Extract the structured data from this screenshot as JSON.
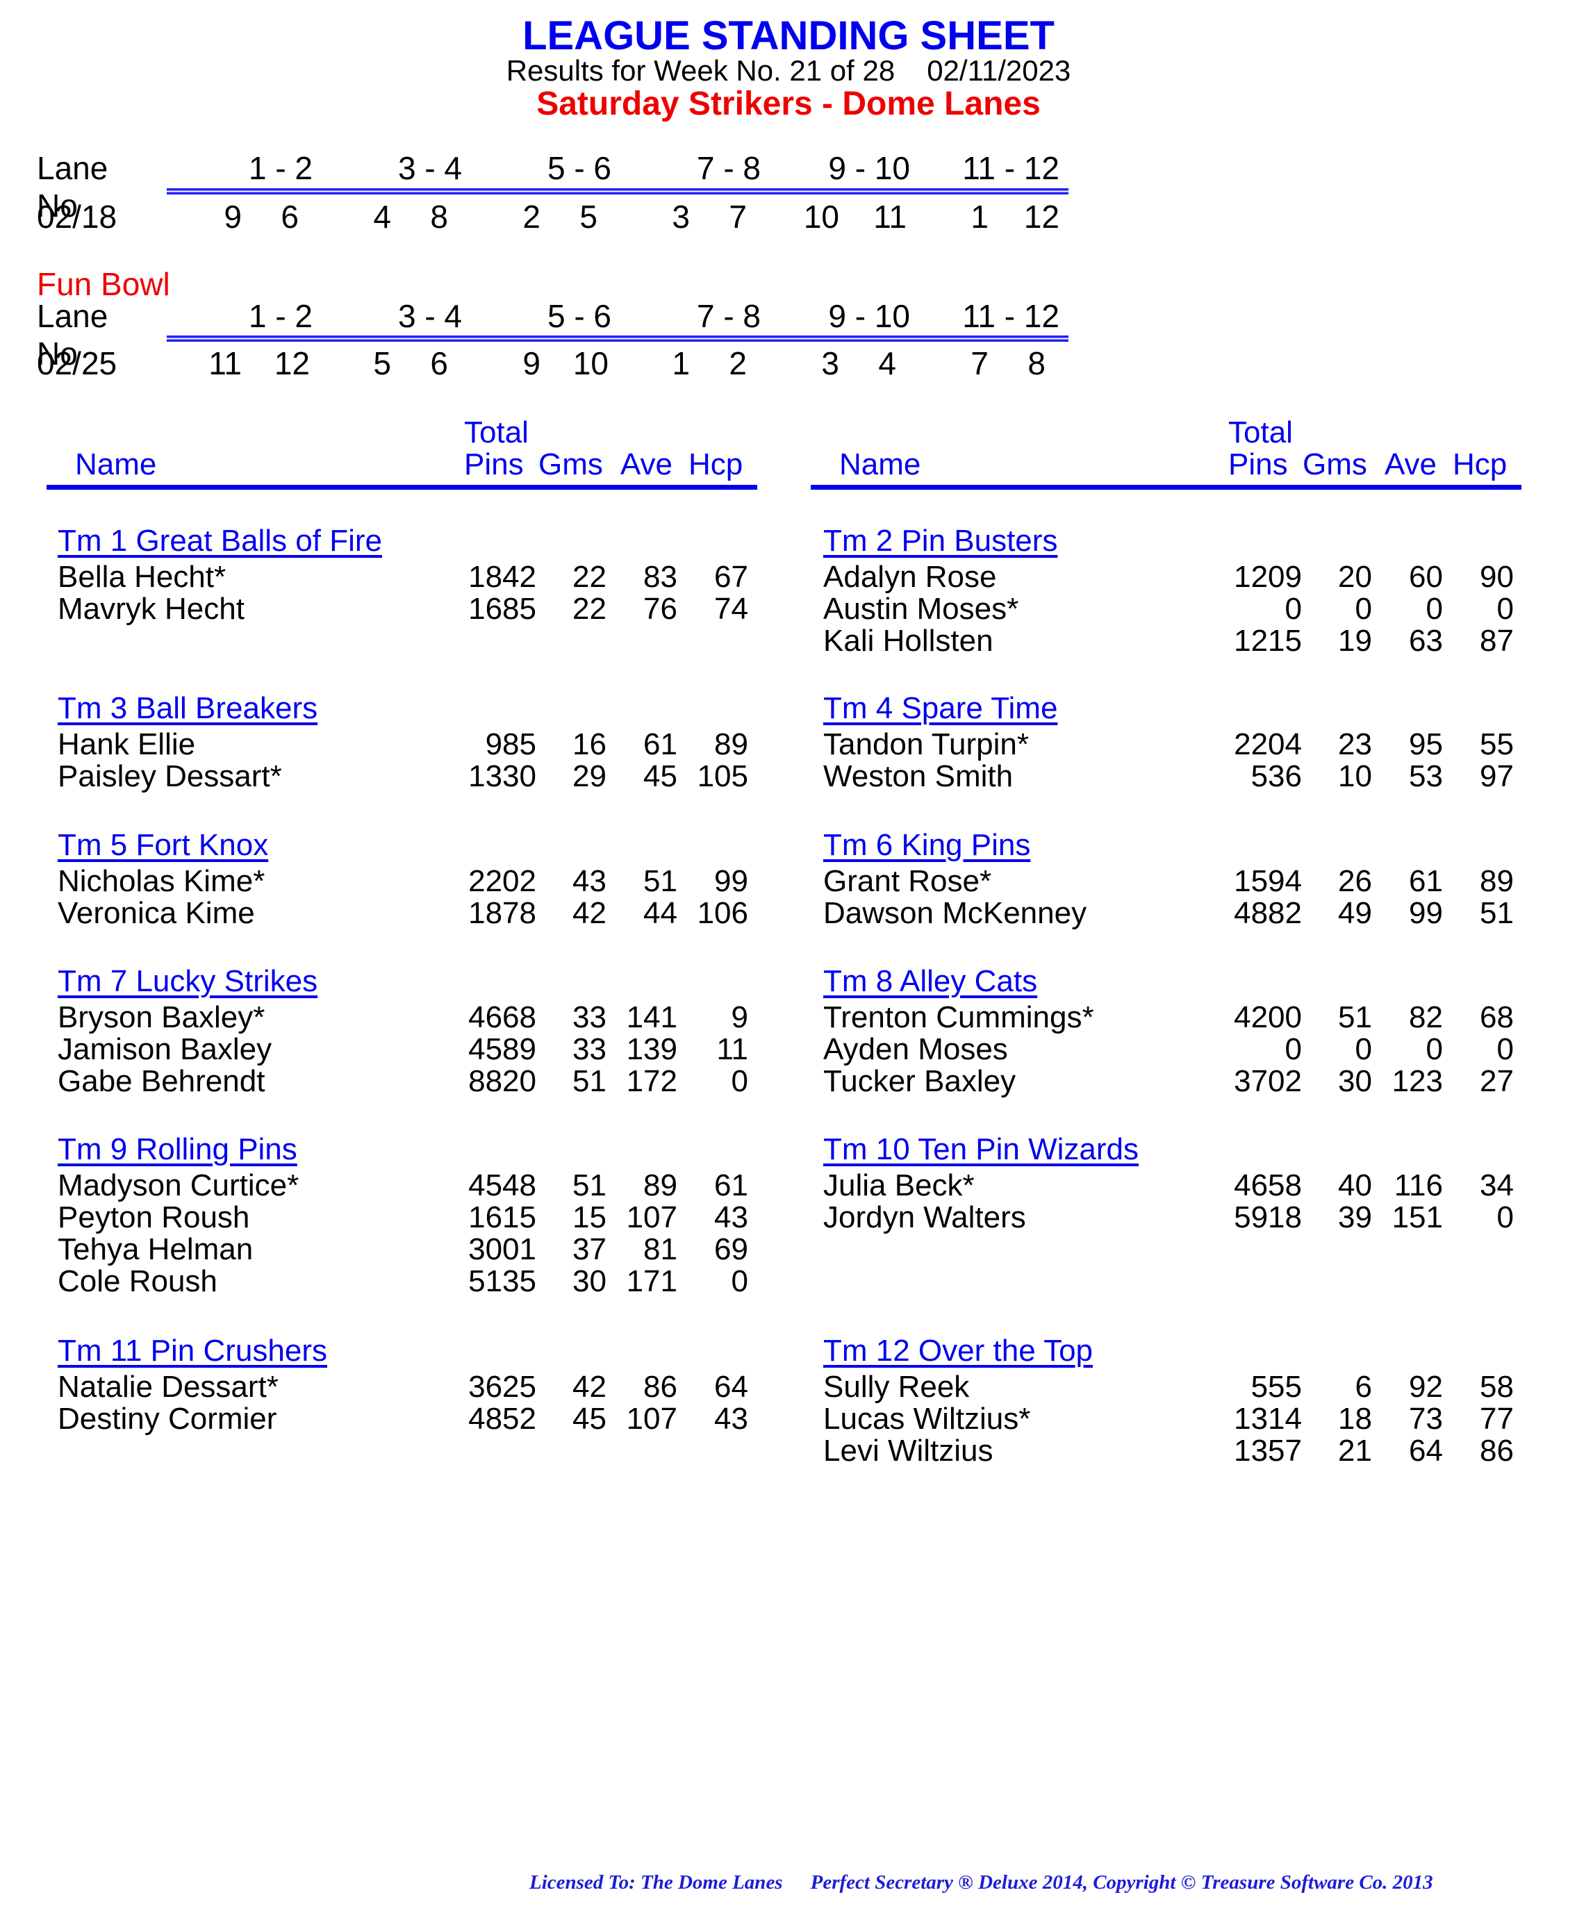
{
  "header": {
    "title": "LEAGUE STANDING SHEET",
    "results_text": "Results for Week No. 21 of 28",
    "date": "02/11/2023",
    "league_name": "Saturday Strikers - Dome Lanes"
  },
  "colors": {
    "title_blue": "#0000ee",
    "league_red": "#ee0000",
    "text_black": "#000000"
  },
  "lane_schedules": [
    {
      "section_label": "",
      "lane_header_label": "Lane No",
      "lanes": [
        "1 -  2",
        "3 -  4",
        "5 -  6",
        "7 -  8",
        "9 - 10",
        "11 - 12"
      ],
      "date": "02/18",
      "pairings": [
        [
          "9",
          "6"
        ],
        [
          "4",
          "8"
        ],
        [
          "2",
          "5"
        ],
        [
          "3",
          "7"
        ],
        [
          "10",
          "11"
        ],
        [
          "1",
          "12"
        ]
      ]
    },
    {
      "section_label": "Fun Bowl",
      "lane_header_label": "Lane No",
      "lanes": [
        "1 -  2",
        "3 -  4",
        "5 -  6",
        "7 -  8",
        "9 - 10",
        "11 - 12"
      ],
      "date": "02/25",
      "pairings": [
        [
          "11",
          "12"
        ],
        [
          "5",
          "6"
        ],
        [
          "9",
          "10"
        ],
        [
          "1",
          "2"
        ],
        [
          "3",
          "4"
        ],
        [
          "7",
          "8"
        ]
      ]
    }
  ],
  "columns": {
    "name": "Name",
    "total_top": "Total",
    "pins": "Pins",
    "games": "Gms",
    "average": "Ave",
    "handicap": "Hcp"
  },
  "teams": [
    {
      "title": "Tm 1 Great Balls of Fire",
      "players": [
        {
          "name": "Bella Hecht*",
          "pins": "1842",
          "gms": "22",
          "ave": "83",
          "hcp": "67"
        },
        {
          "name": "Mavryk Hecht",
          "pins": "1685",
          "gms": "22",
          "ave": "76",
          "hcp": "74"
        }
      ]
    },
    {
      "title": "Tm 2 Pin Busters",
      "players": [
        {
          "name": "Adalyn Rose",
          "pins": "1209",
          "gms": "20",
          "ave": "60",
          "hcp": "90"
        },
        {
          "name": "Austin Moses*",
          "pins": "0",
          "gms": "0",
          "ave": "0",
          "hcp": "0"
        },
        {
          "name": "Kali Hollsten",
          "pins": "1215",
          "gms": "19",
          "ave": "63",
          "hcp": "87"
        }
      ]
    },
    {
      "title": "Tm 3 Ball Breakers",
      "players": [
        {
          "name": "Hank Ellie",
          "pins": "985",
          "gms": "16",
          "ave": "61",
          "hcp": "89"
        },
        {
          "name": "Paisley Dessart*",
          "pins": "1330",
          "gms": "29",
          "ave": "45",
          "hcp": "105"
        }
      ]
    },
    {
      "title": "Tm 4 Spare Time",
      "players": [
        {
          "name": "Tandon Turpin*",
          "pins": "2204",
          "gms": "23",
          "ave": "95",
          "hcp": "55"
        },
        {
          "name": "Weston Smith",
          "pins": "536",
          "gms": "10",
          "ave": "53",
          "hcp": "97"
        }
      ]
    },
    {
      "title": "Tm 5 Fort Knox",
      "players": [
        {
          "name": "Nicholas Kime*",
          "pins": "2202",
          "gms": "43",
          "ave": "51",
          "hcp": "99"
        },
        {
          "name": "Veronica Kime",
          "pins": "1878",
          "gms": "42",
          "ave": "44",
          "hcp": "106"
        }
      ]
    },
    {
      "title": "Tm 6 King Pins",
      "players": [
        {
          "name": "Grant Rose*",
          "pins": "1594",
          "gms": "26",
          "ave": "61",
          "hcp": "89"
        },
        {
          "name": "Dawson McKenney",
          "pins": "4882",
          "gms": "49",
          "ave": "99",
          "hcp": "51"
        }
      ]
    },
    {
      "title": "Tm 7 Lucky Strikes",
      "players": [
        {
          "name": "Bryson Baxley*",
          "pins": "4668",
          "gms": "33",
          "ave": "141",
          "hcp": "9"
        },
        {
          "name": "Jamison Baxley",
          "pins": "4589",
          "gms": "33",
          "ave": "139",
          "hcp": "11"
        },
        {
          "name": "Gabe Behrendt",
          "pins": "8820",
          "gms": "51",
          "ave": "172",
          "hcp": "0"
        }
      ]
    },
    {
      "title": "Tm 8 Alley Cats",
      "players": [
        {
          "name": "Trenton Cummings*",
          "pins": "4200",
          "gms": "51",
          "ave": "82",
          "hcp": "68"
        },
        {
          "name": "Ayden Moses",
          "pins": "0",
          "gms": "0",
          "ave": "0",
          "hcp": "0"
        },
        {
          "name": "Tucker Baxley",
          "pins": "3702",
          "gms": "30",
          "ave": "123",
          "hcp": "27"
        }
      ]
    },
    {
      "title": "Tm 9 Rolling Pins",
      "players": [
        {
          "name": "Madyson Curtice*",
          "pins": "4548",
          "gms": "51",
          "ave": "89",
          "hcp": "61"
        },
        {
          "name": "Peyton Roush",
          "pins": "1615",
          "gms": "15",
          "ave": "107",
          "hcp": "43"
        },
        {
          "name": "Tehya Helman",
          "pins": "3001",
          "gms": "37",
          "ave": "81",
          "hcp": "69"
        },
        {
          "name": "Cole Roush",
          "pins": "5135",
          "gms": "30",
          "ave": "171",
          "hcp": "0"
        }
      ]
    },
    {
      "title": "Tm 10 Ten Pin Wizards",
      "players": [
        {
          "name": "Julia Beck*",
          "pins": "4658",
          "gms": "40",
          "ave": "116",
          "hcp": "34"
        },
        {
          "name": "Jordyn Walters",
          "pins": "5918",
          "gms": "39",
          "ave": "151",
          "hcp": "0"
        }
      ]
    },
    {
      "title": "Tm 11 Pin Crushers",
      "players": [
        {
          "name": "Natalie Dessart*",
          "pins": "3625",
          "gms": "42",
          "ave": "86",
          "hcp": "64"
        },
        {
          "name": "Destiny Cormier",
          "pins": "4852",
          "gms": "45",
          "ave": "107",
          "hcp": "43"
        }
      ]
    },
    {
      "title": "Tm 12 Over the Top",
      "players": [
        {
          "name": "Sully Reek",
          "pins": "555",
          "gms": "6",
          "ave": "92",
          "hcp": "58"
        },
        {
          "name": "Lucas Wiltzius*",
          "pins": "1314",
          "gms": "18",
          "ave": "73",
          "hcp": "77"
        },
        {
          "name": "Levi Wiltzius",
          "pins": "1357",
          "gms": "21",
          "ave": "64",
          "hcp": "86"
        }
      ]
    }
  ],
  "footer": {
    "licensed_to": "Licensed To: The Dome Lanes",
    "software": "Perfect Secretary ® Deluxe  2014, Copyright © Treasure Software Co. 2013"
  }
}
